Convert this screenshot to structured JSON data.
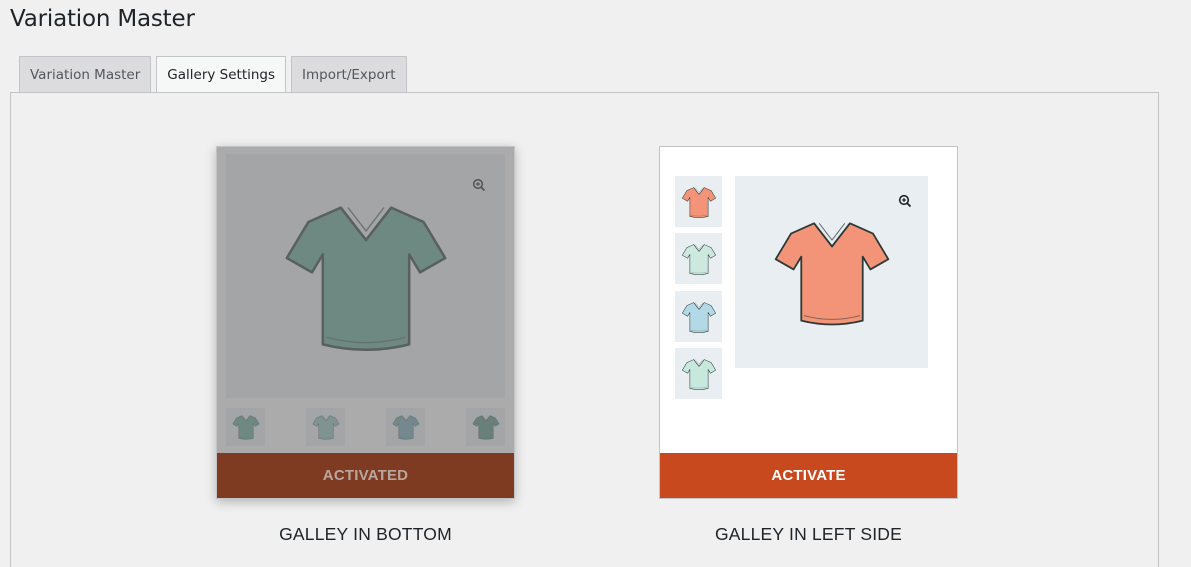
{
  "page": {
    "title": "Variation Master"
  },
  "tabs": [
    {
      "label": "Variation Master",
      "active": false
    },
    {
      "label": "Gallery Settings",
      "active": true
    },
    {
      "label": "Import/Export",
      "active": false
    }
  ],
  "cards": [
    {
      "caption": "GALLEY IN BOTTOM",
      "button_label": "ACTIVATED",
      "activated": true,
      "main_shirt_color": "#5fa691",
      "thumb_colors": [
        "#5fa691",
        "#8fbfc0",
        "#6ea7b4",
        "#4f8f7c"
      ]
    },
    {
      "caption": "GALLEY IN LEFT SIDE",
      "button_label": "ACTIVATE",
      "activated": false,
      "main_shirt_color": "#f39478",
      "thumb_colors": [
        "#f39478",
        "#cde9df",
        "#b3d8e6",
        "#c7e8dd"
      ]
    }
  ],
  "colors": {
    "accent": "#c9491e",
    "accent_dim": "#7e3b21"
  },
  "icons": {
    "zoom": "zoom-in-icon",
    "product": "tshirt-icon"
  }
}
